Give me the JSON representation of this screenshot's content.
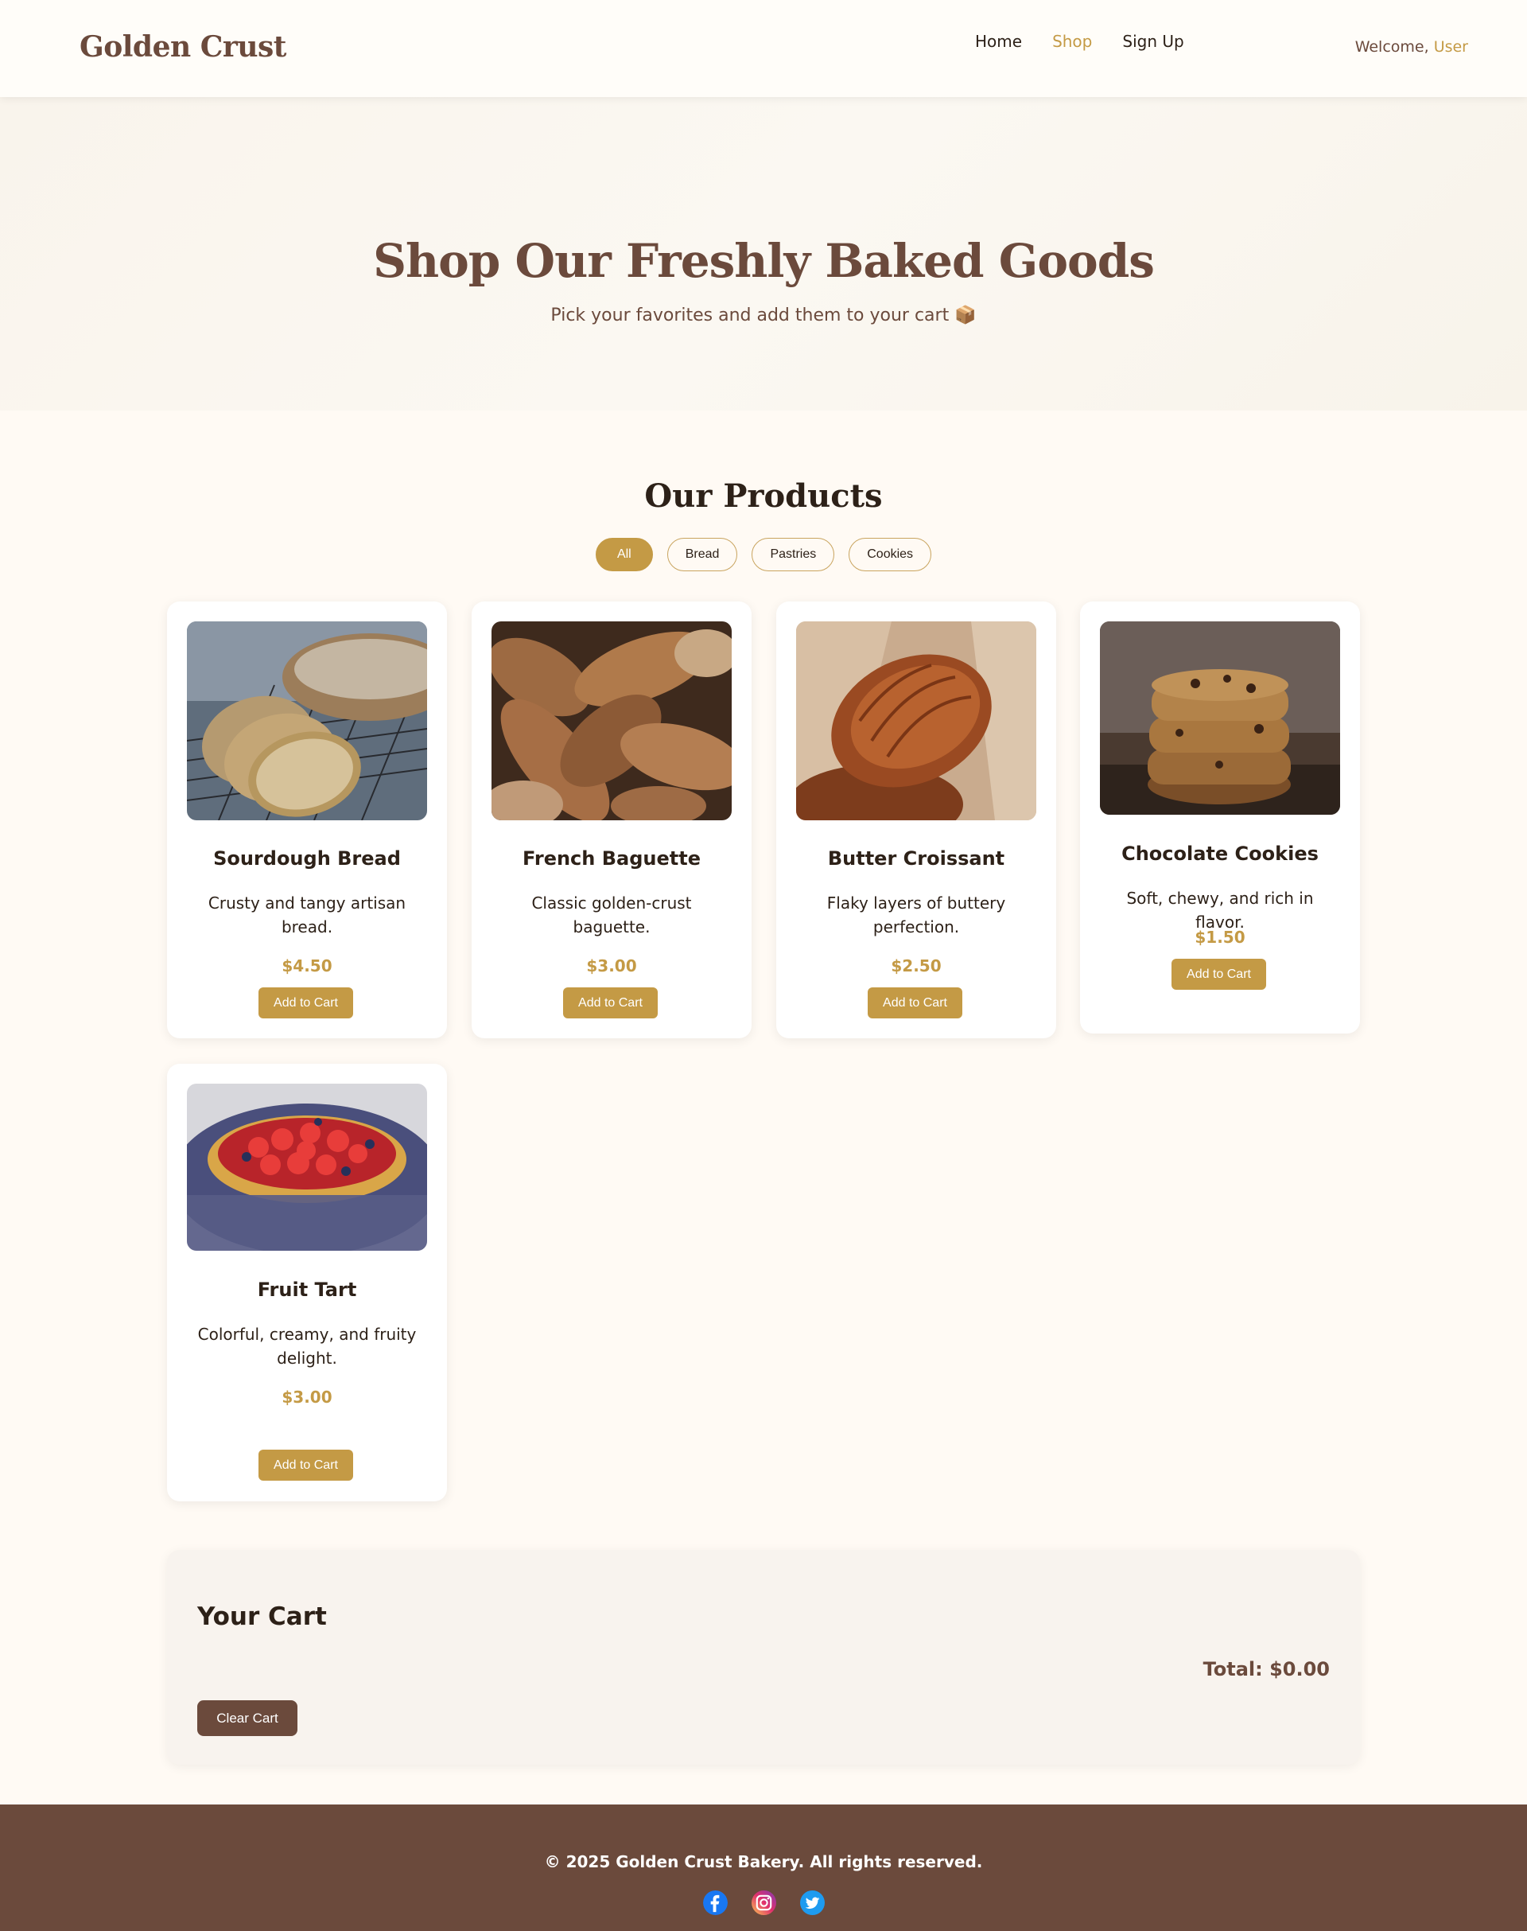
{
  "header": {
    "logo": "Golden Crust",
    "nav": [
      {
        "label": "Home",
        "active": false
      },
      {
        "label": "Shop",
        "active": true
      },
      {
        "label": "Sign Up",
        "active": false
      }
    ],
    "welcome_prefix": "Welcome,",
    "user_name": "User"
  },
  "hero": {
    "title": "Shop Our Freshly Baked Goods",
    "subtitle": "Pick your favorites and add them to your cart 📦"
  },
  "products_section": {
    "title": "Our Products",
    "filters": [
      "All",
      "Bread",
      "Pastries",
      "Cookies"
    ],
    "active_filter": "All"
  },
  "products": [
    {
      "name": "Sourdough Bread",
      "description": "Crusty and tangy artisan bread.",
      "price": "$4.50",
      "button": "Add to Cart",
      "image_icon": "sourdough-bread-photo"
    },
    {
      "name": "French Baguette",
      "description": "Classic golden-crust baguette.",
      "price": "$3.00",
      "button": "Add to Cart",
      "image_icon": "french-baguette-photo"
    },
    {
      "name": "Butter Croissant",
      "description": "Flaky layers of buttery perfection.",
      "price": "$2.50",
      "button": "Add to Cart",
      "image_icon": "butter-croissant-photo"
    },
    {
      "name": "Chocolate Cookies",
      "description": "Soft, chewy, and rich in flavor.",
      "price": "$1.50",
      "button": "Add to Cart",
      "image_icon": "chocolate-cookies-photo"
    },
    {
      "name": "Fruit Tart",
      "description": "Colorful, creamy, and fruity delight.",
      "price": "$3.00",
      "button": "Add to Cart",
      "image_icon": "fruit-tart-photo"
    }
  ],
  "cart": {
    "title": "Your Cart",
    "total": "Total: $0.00",
    "clear_button": "Clear Cart"
  },
  "footer": {
    "copyright": "© 2025 Golden Crust Bakery. All rights reserved.",
    "socials": [
      "facebook-icon",
      "instagram-icon",
      "twitter-icon"
    ]
  },
  "colors": {
    "accent": "#c49a45",
    "brown": "#6b4a3c",
    "background": "#fffaf4"
  }
}
